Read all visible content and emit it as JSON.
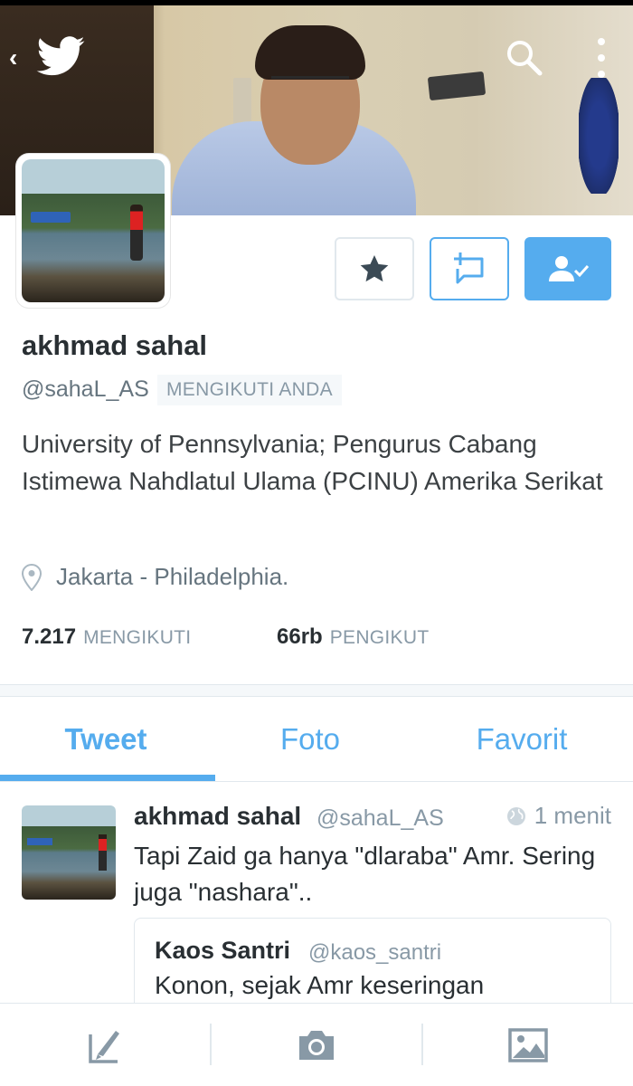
{
  "profile": {
    "name": "akhmad sahal",
    "handle": "@sahaL_AS",
    "follows_you_badge": "MENGIKUTI ANDA",
    "bio": "University of Pennsylvania; Pengurus Cabang Istimewa Nahdlatul Ulama (PCINU) Amerika Serikat",
    "location": "Jakarta - Philadelphia."
  },
  "stats": {
    "following_count": "7.217",
    "following_label": "MENGIKUTI",
    "followers_count": "66rb",
    "followers_label": "PENGIKUT"
  },
  "tabs": [
    {
      "label": "Tweet",
      "active": true
    },
    {
      "label": "Foto",
      "active": false
    },
    {
      "label": "Favorit",
      "active": false
    }
  ],
  "tweet": {
    "author_name": "akhmad sahal",
    "author_handle": "@sahaL_AS",
    "time": "1 menit",
    "text": "Tapi Zaid ga hanya \"dlaraba\"  Amr. Sering juga \"nashara\"..",
    "quote": {
      "author_name": "Kaos Santri",
      "author_handle": "@kaos_santri",
      "text": "Konon, sejak Amr keseringan"
    }
  },
  "icons": {
    "back": "back-icon",
    "brand": "twitter-bird-icon",
    "search": "search-icon",
    "more": "more-vertical-icon",
    "star": "star-icon",
    "message": "direct-message-icon",
    "following": "user-following-icon",
    "location": "location-pin-icon",
    "globe": "globe-icon",
    "compose": "compose-icon",
    "camera": "camera-icon",
    "gallery": "gallery-icon"
  },
  "colors": {
    "accent": "#55acee",
    "text": "#292f33",
    "muted": "#8899a6",
    "border": "#e1e8ed"
  }
}
